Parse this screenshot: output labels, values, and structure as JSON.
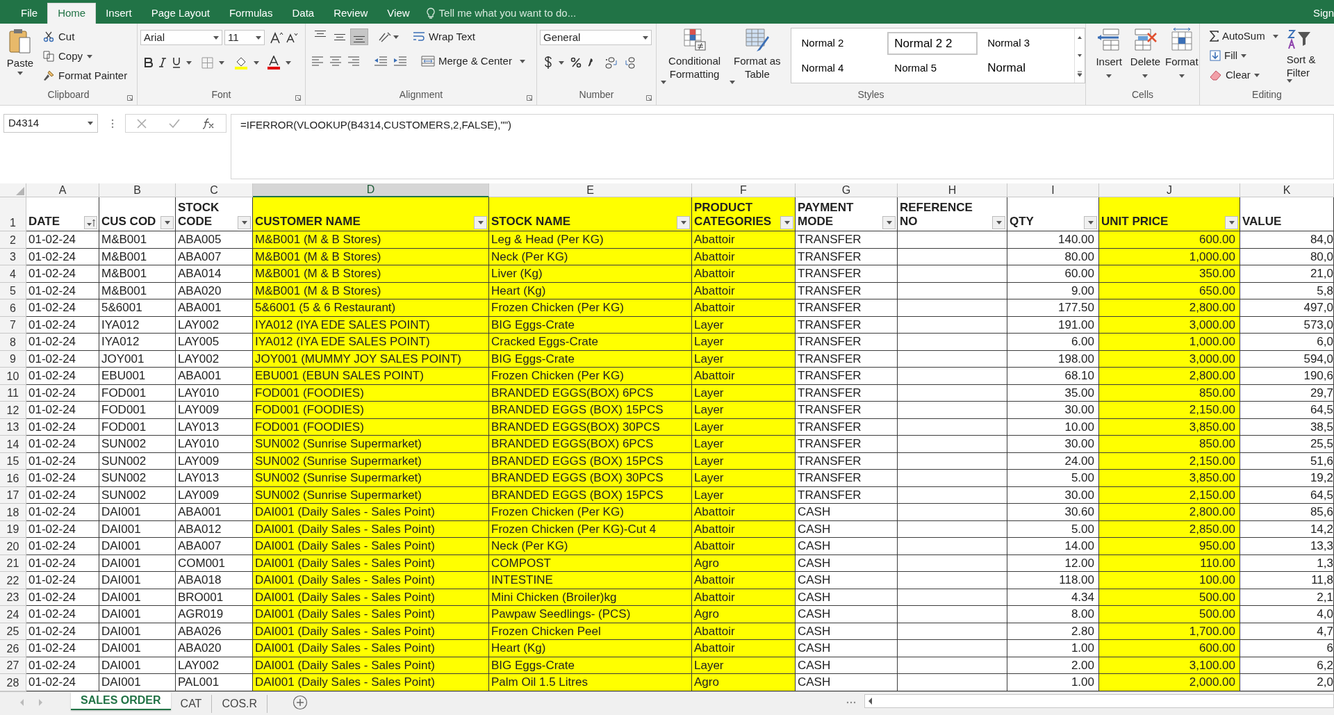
{
  "title_bar": {
    "tabs": [
      {
        "label": "File",
        "selected": false
      },
      {
        "label": "Home",
        "selected": true
      },
      {
        "label": "Insert",
        "selected": false
      },
      {
        "label": "Page Layout",
        "selected": false
      },
      {
        "label": "Formulas",
        "selected": false
      },
      {
        "label": "Data",
        "selected": false
      },
      {
        "label": "Review",
        "selected": false
      },
      {
        "label": "View",
        "selected": false
      }
    ],
    "tell_me": "Tell me what you want to do...",
    "account": "Sign"
  },
  "ribbon": {
    "clipboard": {
      "label": "Clipboard",
      "paste": "Paste",
      "cut": "Cut",
      "copy": "Copy",
      "format_painter": "Format Painter"
    },
    "font": {
      "label": "Font",
      "font_name": "Arial",
      "font_size": "11"
    },
    "alignment": {
      "label": "Alignment",
      "vertical_align": [
        {
          "kind": "top",
          "selected": false
        },
        {
          "kind": "middle",
          "selected": false
        },
        {
          "kind": "bottom",
          "selected": true
        }
      ],
      "wrap_text": "Wrap Text",
      "merge_center": "Merge & Center"
    },
    "number": {
      "label": "Number",
      "format": "General"
    },
    "styles": {
      "label": "Styles",
      "conditional_formatting": "Conditional Formatting",
      "format_as_table": "Format as Table",
      "gallery": [
        {
          "label": "Normal 2",
          "selected": false
        },
        {
          "label": "Normal 2 2",
          "selected": true
        },
        {
          "label": "Normal 3",
          "selected": false
        },
        {
          "label": "Normal 4",
          "selected": false
        },
        {
          "label": "Normal 5",
          "selected": false
        },
        {
          "label": "Normal",
          "selected": false
        }
      ]
    },
    "cells": {
      "label": "Cells",
      "insert": "Insert",
      "delete": "Delete",
      "format": "Format"
    },
    "editing": {
      "label": "Editing",
      "autosum": "AutoSum",
      "fill": "Fill",
      "clear": "Clear",
      "sort_filter": "Sort & Filter"
    }
  },
  "formula_bar": {
    "name_box": "D4314",
    "formula": "=IFERROR(VLOOKUP(B4314,CUSTOMERS,2,FALSE),\"\")"
  },
  "sheet": {
    "columns": [
      {
        "letter": "A",
        "selected": false,
        "highlighted": false,
        "header": "DATE",
        "kind": "sort"
      },
      {
        "letter": "B",
        "selected": false,
        "highlighted": false,
        "header": "CUS COD",
        "kind": "dropdown"
      },
      {
        "letter": "C",
        "selected": false,
        "highlighted": false,
        "header": "STOCK\nCODE",
        "kind": "dropdown"
      },
      {
        "letter": "D",
        "selected": true,
        "highlighted": true,
        "header": "CUSTOMER NAME",
        "kind": "dropdown"
      },
      {
        "letter": "E",
        "selected": false,
        "highlighted": true,
        "header": "STOCK NAME",
        "kind": "dropdown"
      },
      {
        "letter": "F",
        "selected": false,
        "highlighted": true,
        "header": "PRODUCT\nCATEGORIES",
        "kind": "dropdown"
      },
      {
        "letter": "G",
        "selected": false,
        "highlighted": false,
        "header": "PAYMENT\nMODE",
        "kind": "dropdown"
      },
      {
        "letter": "H",
        "selected": false,
        "highlighted": false,
        "header": "REFERENCE\nNO",
        "kind": "dropdown"
      },
      {
        "letter": "I",
        "selected": false,
        "highlighted": false,
        "header": "QTY",
        "kind": "dropdown"
      },
      {
        "letter": "J",
        "selected": false,
        "highlighted": true,
        "header": "UNIT PRICE",
        "kind": "dropdown"
      },
      {
        "letter": "K",
        "selected": false,
        "highlighted": false,
        "header": "VALUE",
        "kind": "plain"
      }
    ],
    "header_row_number": "1",
    "rows": [
      {
        "number": "2",
        "date": "01-02-24",
        "cus_code": "M&B001",
        "stock_code": "ABA005",
        "customer_name": "M&B001 (M & B Stores)",
        "stock_name": "Leg & Head  (Per KG)",
        "product_category": "Abattoir",
        "payment_mode": "TRANSFER",
        "qty": "140.00",
        "unit_price": "600.00",
        "value": "84,0"
      },
      {
        "number": "3",
        "date": "01-02-24",
        "cus_code": "M&B001",
        "stock_code": "ABA007",
        "customer_name": "M&B001 (M & B Stores)",
        "stock_name": "Neck (Per KG)",
        "product_category": "Abattoir",
        "payment_mode": "TRANSFER",
        "qty": "80.00",
        "unit_price": "1,000.00",
        "value": "80,0"
      },
      {
        "number": "4",
        "date": "01-02-24",
        "cus_code": "M&B001",
        "stock_code": "ABA014",
        "customer_name": "M&B001 (M & B Stores)",
        "stock_name": "Liver (Kg)",
        "product_category": "Abattoir",
        "payment_mode": "TRANSFER",
        "qty": "60.00",
        "unit_price": "350.00",
        "value": "21,0"
      },
      {
        "number": "5",
        "date": "01-02-24",
        "cus_code": "M&B001",
        "stock_code": "ABA020",
        "customer_name": "M&B001 (M & B Stores)",
        "stock_name": "Heart (Kg)",
        "product_category": "Abattoir",
        "payment_mode": "TRANSFER",
        "qty": "9.00",
        "unit_price": "650.00",
        "value": "5,8"
      },
      {
        "number": "6",
        "date": "01-02-24",
        "cus_code": "5&6001",
        "stock_code": "ABA001",
        "customer_name": "5&6001 (5 & 6 Restaurant)",
        "stock_name": "Frozen Chicken (Per KG)",
        "product_category": "Abattoir",
        "payment_mode": "TRANSFER",
        "qty": "177.50",
        "unit_price": "2,800.00",
        "value": "497,0"
      },
      {
        "number": "7",
        "date": "01-02-24",
        "cus_code": "IYA012",
        "stock_code": "LAY002",
        "customer_name": "IYA012 (IYA EDE SALES POINT)",
        "stock_name": "BIG Eggs-Crate",
        "product_category": "Layer",
        "payment_mode": "TRANSFER",
        "qty": "191.00",
        "unit_price": "3,000.00",
        "value": "573,0"
      },
      {
        "number": "8",
        "date": "01-02-24",
        "cus_code": "IYA012",
        "stock_code": "LAY005",
        "customer_name": "IYA012 (IYA EDE SALES POINT)",
        "stock_name": "Cracked Eggs-Crate",
        "product_category": "Layer",
        "payment_mode": "TRANSFER",
        "qty": "6.00",
        "unit_price": "1,000.00",
        "value": "6,0"
      },
      {
        "number": "9",
        "date": "01-02-24",
        "cus_code": "JOY001",
        "stock_code": "LAY002",
        "customer_name": "JOY001 (MUMMY JOY SALES POINT)",
        "stock_name": "BIG Eggs-Crate",
        "product_category": "Layer",
        "payment_mode": "TRANSFER",
        "qty": "198.00",
        "unit_price": "3,000.00",
        "value": "594,0"
      },
      {
        "number": "10",
        "date": "01-02-24",
        "cus_code": "EBU001",
        "stock_code": "ABA001",
        "customer_name": "EBU001 (EBUN SALES POINT)",
        "stock_name": "Frozen Chicken (Per KG)",
        "product_category": "Abattoir",
        "payment_mode": "TRANSFER",
        "qty": "68.10",
        "unit_price": "2,800.00",
        "value": "190,6"
      },
      {
        "number": "11",
        "date": "01-02-24",
        "cus_code": "FOD001",
        "stock_code": "LAY010",
        "customer_name": "FOD001 (FOODIES)",
        "stock_name": "BRANDED EGGS(BOX) 6PCS",
        "product_category": "Layer",
        "payment_mode": "TRANSFER",
        "qty": "35.00",
        "unit_price": "850.00",
        "value": "29,7"
      },
      {
        "number": "12",
        "date": "01-02-24",
        "cus_code": "FOD001",
        "stock_code": "LAY009",
        "customer_name": "FOD001 (FOODIES)",
        "stock_name": "BRANDED EGGS (BOX) 15PCS",
        "product_category": "Layer",
        "payment_mode": "TRANSFER",
        "qty": "30.00",
        "unit_price": "2,150.00",
        "value": "64,5"
      },
      {
        "number": "13",
        "date": "01-02-24",
        "cus_code": "FOD001",
        "stock_code": "LAY013",
        "customer_name": "FOD001 (FOODIES)",
        "stock_name": "BRANDED EGGS(BOX) 30PCS",
        "product_category": "Layer",
        "payment_mode": "TRANSFER",
        "qty": "10.00",
        "unit_price": "3,850.00",
        "value": "38,5"
      },
      {
        "number": "14",
        "date": "01-02-24",
        "cus_code": "SUN002",
        "stock_code": "LAY010",
        "customer_name": "SUN002 (Sunrise Supermarket)",
        "stock_name": "BRANDED EGGS(BOX) 6PCS",
        "product_category": "Layer",
        "payment_mode": "TRANSFER",
        "qty": "30.00",
        "unit_price": "850.00",
        "value": "25,5"
      },
      {
        "number": "15",
        "date": "01-02-24",
        "cus_code": "SUN002",
        "stock_code": "LAY009",
        "customer_name": "SUN002 (Sunrise Supermarket)",
        "stock_name": "BRANDED EGGS (BOX) 15PCS",
        "product_category": "Layer",
        "payment_mode": "TRANSFER",
        "qty": "24.00",
        "unit_price": "2,150.00",
        "value": "51,6"
      },
      {
        "number": "16",
        "date": "01-02-24",
        "cus_code": "SUN002",
        "stock_code": "LAY013",
        "customer_name": "SUN002 (Sunrise Supermarket)",
        "stock_name": "BRANDED EGGS (BOX) 30PCS",
        "product_category": "Layer",
        "payment_mode": "TRANSFER",
        "qty": "5.00",
        "unit_price": "3,850.00",
        "value": "19,2"
      },
      {
        "number": "17",
        "date": "01-02-24",
        "cus_code": "SUN002",
        "stock_code": "LAY009",
        "customer_name": "SUN002 (Sunrise Supermarket)",
        "stock_name": "BRANDED EGGS (BOX) 15PCS",
        "product_category": "Layer",
        "payment_mode": "TRANSFER",
        "qty": "30.00",
        "unit_price": "2,150.00",
        "value": "64,5"
      },
      {
        "number": "18",
        "date": "01-02-24",
        "cus_code": "DAI001",
        "stock_code": "ABA001",
        "customer_name": "DAI001 (Daily Sales - Sales Point)",
        "stock_name": "Frozen Chicken (Per KG)",
        "product_category": "Abattoir",
        "payment_mode": "CASH",
        "qty": "30.60",
        "unit_price": "2,800.00",
        "value": "85,6"
      },
      {
        "number": "19",
        "date": "01-02-24",
        "cus_code": "DAI001",
        "stock_code": "ABA012",
        "customer_name": "DAI001 (Daily Sales - Sales Point)",
        "stock_name": "Frozen Chicken (Per KG)-Cut 4",
        "product_category": "Abattoir",
        "payment_mode": "CASH",
        "qty": "5.00",
        "unit_price": "2,850.00",
        "value": "14,2"
      },
      {
        "number": "20",
        "date": "01-02-24",
        "cus_code": "DAI001",
        "stock_code": "ABA007",
        "customer_name": "DAI001 (Daily Sales - Sales Point)",
        "stock_name": "Neck (Per KG)",
        "product_category": "Abattoir",
        "payment_mode": "CASH",
        "qty": "14.00",
        "unit_price": "950.00",
        "value": "13,3"
      },
      {
        "number": "21",
        "date": "01-02-24",
        "cus_code": "DAI001",
        "stock_code": "COM001",
        "customer_name": "DAI001 (Daily Sales - Sales Point)",
        "stock_name": "COMPOST",
        "product_category": "Agro",
        "payment_mode": "CASH",
        "qty": "12.00",
        "unit_price": "110.00",
        "value": "1,3"
      },
      {
        "number": "22",
        "date": "01-02-24",
        "cus_code": "DAI001",
        "stock_code": "ABA018",
        "customer_name": "DAI001 (Daily Sales - Sales Point)",
        "stock_name": "INTESTINE",
        "product_category": "Abattoir",
        "payment_mode": "CASH",
        "qty": "118.00",
        "unit_price": "100.00",
        "value": "11,8"
      },
      {
        "number": "23",
        "date": "01-02-24",
        "cus_code": "DAI001",
        "stock_code": "BRO001",
        "customer_name": "DAI001 (Daily Sales - Sales Point)",
        "stock_name": "Mini Chicken (Broiler)kg",
        "product_category": "Abattoir",
        "payment_mode": "CASH",
        "qty": "4.34",
        "unit_price": "500.00",
        "value": "2,1"
      },
      {
        "number": "24",
        "date": "01-02-24",
        "cus_code": "DAI001",
        "stock_code": "AGR019",
        "customer_name": "DAI001 (Daily Sales - Sales Point)",
        "stock_name": "Pawpaw Seedlings- (PCS)",
        "product_category": "Agro",
        "payment_mode": "CASH",
        "qty": "8.00",
        "unit_price": "500.00",
        "value": "4,0"
      },
      {
        "number": "25",
        "date": "01-02-24",
        "cus_code": "DAI001",
        "stock_code": "ABA026",
        "customer_name": "DAI001 (Daily Sales - Sales Point)",
        "stock_name": "Frozen Chicken Peel",
        "product_category": "Abattoir",
        "payment_mode": "CASH",
        "qty": "2.80",
        "unit_price": "1,700.00",
        "value": "4,7"
      },
      {
        "number": "26",
        "date": "01-02-24",
        "cus_code": "DAI001",
        "stock_code": "ABA020",
        "customer_name": "DAI001 (Daily Sales - Sales Point)",
        "stock_name": "Heart (Kg)",
        "product_category": "Abattoir",
        "payment_mode": "CASH",
        "qty": "1.00",
        "unit_price": "600.00",
        "value": "6"
      },
      {
        "number": "27",
        "date": "01-02-24",
        "cus_code": "DAI001",
        "stock_code": "LAY002",
        "customer_name": "DAI001 (Daily Sales - Sales Point)",
        "stock_name": "BIG Eggs-Crate",
        "product_category": "Layer",
        "payment_mode": "CASH",
        "qty": "2.00",
        "unit_price": "3,100.00",
        "value": "6,2"
      },
      {
        "number": "28",
        "date": "01-02-24",
        "cus_code": "DAI001",
        "stock_code": "PAL001",
        "customer_name": "DAI001 (Daily Sales - Sales Point)",
        "stock_name": "Palm Oil 1.5 Litres",
        "product_category": "Agro",
        "payment_mode": "CASH",
        "qty": "1.00",
        "unit_price": "2,000.00",
        "value": "2,0"
      }
    ]
  },
  "sheet_tabs": [
    {
      "label": "SALES ORDER",
      "selected": true
    },
    {
      "label": "CAT",
      "selected": false
    },
    {
      "label": "COS.R",
      "selected": false
    }
  ]
}
